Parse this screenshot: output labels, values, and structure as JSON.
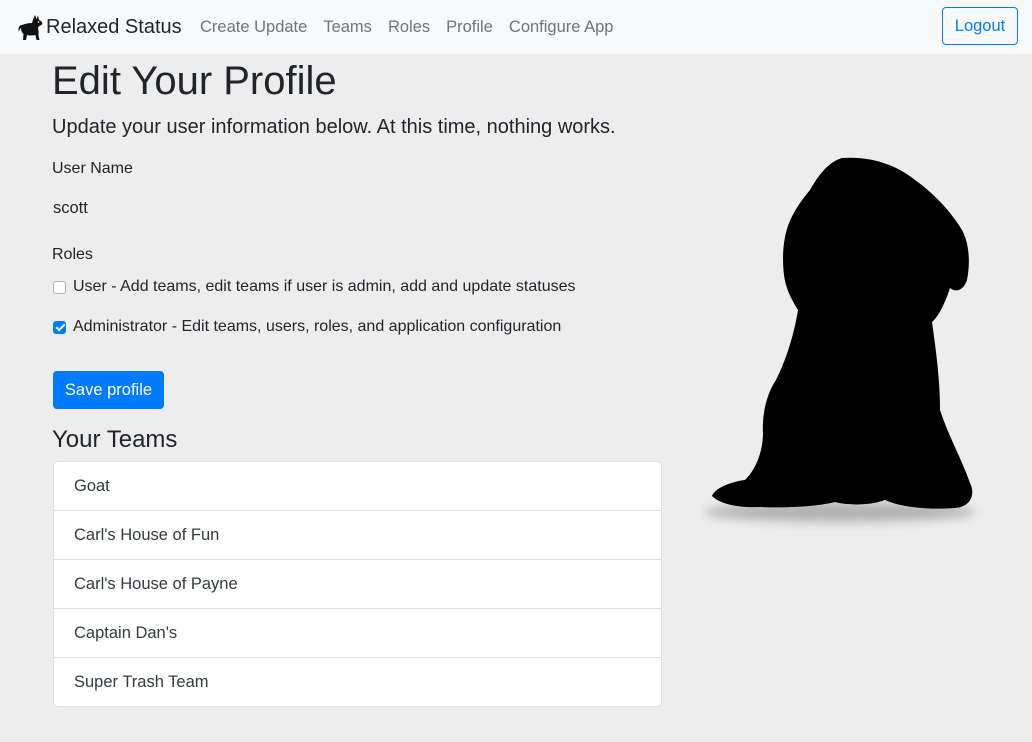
{
  "nav": {
    "brand": "Relaxed Status",
    "links": [
      "Create Update",
      "Teams",
      "Roles",
      "Profile",
      "Configure App"
    ],
    "logout": "Logout"
  },
  "page": {
    "title": "Edit Your Profile",
    "lead": "Update your user information below. At this time, nothing works."
  },
  "form": {
    "username_label": "User Name",
    "username_value": "scott",
    "roles_label": "Roles",
    "roles": [
      {
        "label": "User - Add teams, edit teams if user is admin, add and update statuses",
        "checked": false
      },
      {
        "label": "Administrator - Edit teams, users, roles, and application configuration",
        "checked": true
      }
    ],
    "save_label": "Save profile"
  },
  "teams": {
    "title": "Your Teams",
    "items": [
      "Goat",
      "Carl's House of Fun",
      "Carl's House of Payne",
      "Captain Dan's",
      "Super Trash Team"
    ]
  },
  "icons": {
    "brand": "dog-logo-icon",
    "illustration": "dog-silhouette"
  },
  "colors": {
    "primary": "#007bff",
    "background": "#ededed",
    "navbar": "#f8f9fa"
  }
}
